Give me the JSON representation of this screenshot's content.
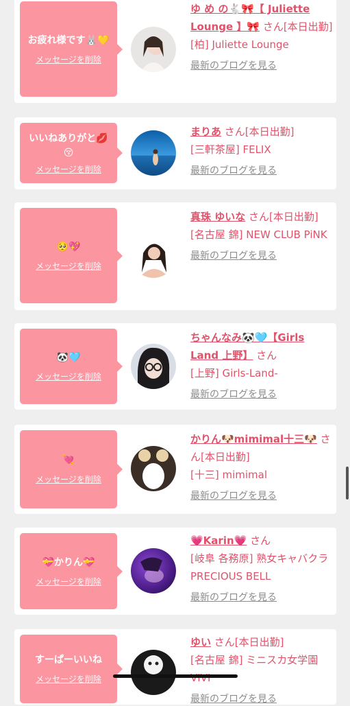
{
  "cards": [
    {
      "message": "お疲れ様です🐰💛",
      "delete_label": "メッセージを削除",
      "name": "ゆ め の🐇🎀【 Juliette Lounge 】🎀",
      "suffix": "さん[本日出勤]",
      "shop": "[柏] Juliette Lounge",
      "blog_label": "最新のブログを見る",
      "avatar_icon": "woman-portrait-icon"
    },
    {
      "message": "いいねありがと💋😚",
      "delete_label": "メッセージを削除",
      "name": "まりあ",
      "suffix": "さん[本日出勤]",
      "shop": "[三軒茶屋] FELIX",
      "blog_label": "最新のブログを見る",
      "avatar_icon": "beach-photo-icon"
    },
    {
      "message": "🥺💖",
      "delete_label": "メッセージを削除",
      "name": "真珠 ゆいな",
      "suffix": "さん[本日出勤]",
      "shop": "[名古屋 錦] NEW CLUB PiNK",
      "blog_label": "最新のブログを見る",
      "avatar_icon": "woman-portrait-icon"
    },
    {
      "message": "🐼🩵",
      "delete_label": "メッセージを削除",
      "name": "ちゃんなみ🐼🩵【Girls Land 上野】",
      "suffix": "さん",
      "shop": "[上野] Girls-Land-",
      "blog_label": "最新のブログを見る",
      "avatar_icon": "woman-glasses-icon"
    },
    {
      "message": "💘",
      "delete_label": "メッセージを削除",
      "name": "かりん🐶mimimal十三🐶",
      "suffix": "さん[本日出勤]",
      "shop": "[十三] mimimal",
      "blog_label": "最新のブログを見る",
      "avatar_icon": "masked-portrait-icon"
    },
    {
      "message": "💝かりん💝",
      "delete_label": "メッセージを削除",
      "name": "💗Karin💗",
      "suffix": "さん",
      "shop": "[岐阜 各務原] 熟女キャバクラ PRECIOUS BELL",
      "blog_label": "最新のブログを見る",
      "avatar_icon": "purple-portrait-icon"
    },
    {
      "message": "すーぱーいいね",
      "delete_label": "メッセージを削除",
      "name": "ゆい",
      "suffix": "さん[本日出勤]",
      "shop": "[名古屋 錦] ミニスカ女学園VIVI",
      "blog_label": "最新のブログを見る",
      "avatar_icon": "cat-portrait-icon"
    }
  ]
}
